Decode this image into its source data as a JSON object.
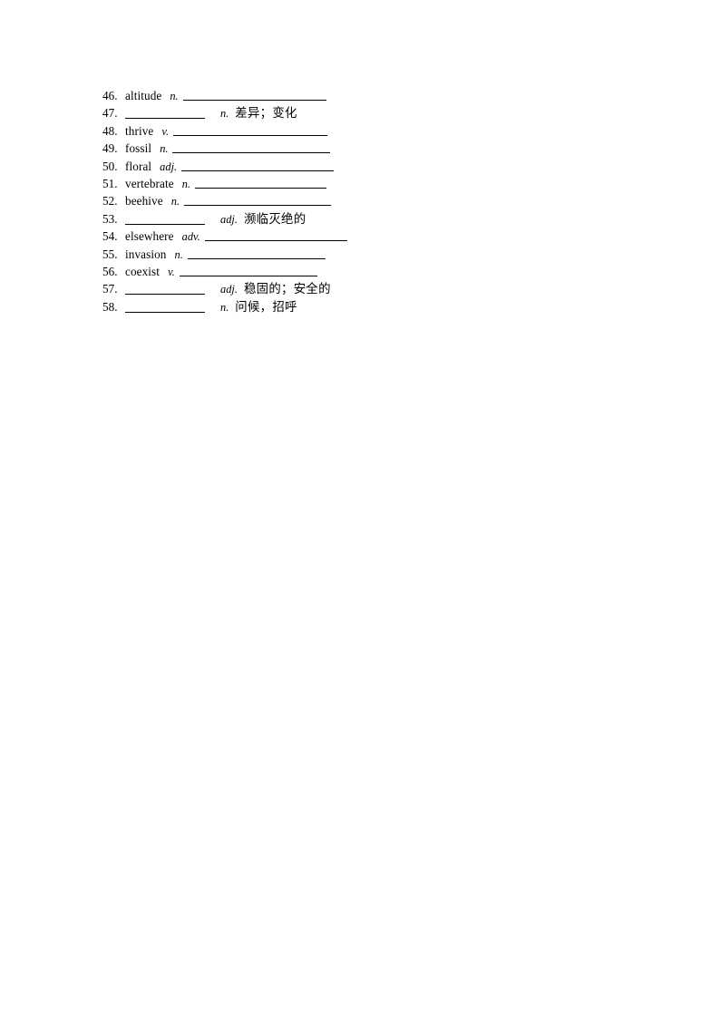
{
  "page": {
    "background_color": "#ffffff",
    "text_color": "#000000",
    "rule_color": "#000000"
  },
  "worksheet": {
    "rows": [
      {
        "number": "46.",
        "word": "altitude",
        "pos": "n.",
        "answer": "",
        "has_blank_word": false,
        "has_answer_line": true
      },
      {
        "number": "47.",
        "word": "",
        "pos": "n.",
        "answer": "差异；变化",
        "has_blank_word": true,
        "has_answer_line": false
      },
      {
        "number": "48.",
        "word": "thrive",
        "pos": "v.",
        "answer": "",
        "has_blank_word": false,
        "has_answer_line": true
      },
      {
        "number": "49.",
        "word": "fossil",
        "pos": "n.",
        "answer": "",
        "has_blank_word": false,
        "has_answer_line": true
      },
      {
        "number": "50.",
        "word": "floral",
        "pos": "adj.",
        "answer": "",
        "has_blank_word": false,
        "has_answer_line": true
      },
      {
        "number": "51.",
        "word": "vertebrate",
        "pos": "n.",
        "answer": "",
        "has_blank_word": false,
        "has_answer_line": true
      },
      {
        "number": "52.",
        "word": "beehive",
        "pos": "n.",
        "answer": "",
        "has_blank_word": false,
        "has_answer_line": true
      },
      {
        "number": "53.",
        "word": "",
        "pos": "adj.",
        "answer": "濒临灭绝的",
        "has_blank_word": true,
        "has_answer_line": false
      },
      {
        "number": "54.",
        "word": "elsewhere",
        "pos": "adv.",
        "answer": "",
        "has_blank_word": false,
        "has_answer_line": true
      },
      {
        "number": "55.",
        "word": "invasion",
        "pos": "n.",
        "answer": "",
        "has_blank_word": false,
        "has_answer_line": true
      },
      {
        "number": "56.",
        "word": "coexist",
        "pos": "v.",
        "answer": "",
        "has_blank_word": false,
        "has_answer_line": true
      },
      {
        "number": "57.",
        "word": "",
        "pos": "adj.",
        "answer": "稳固的；安全的",
        "has_blank_word": true,
        "has_answer_line": false
      },
      {
        "number": "58.",
        "word": "",
        "pos": "n.",
        "answer": "问候，招呼",
        "has_blank_word": true,
        "has_answer_line": false
      }
    ]
  }
}
